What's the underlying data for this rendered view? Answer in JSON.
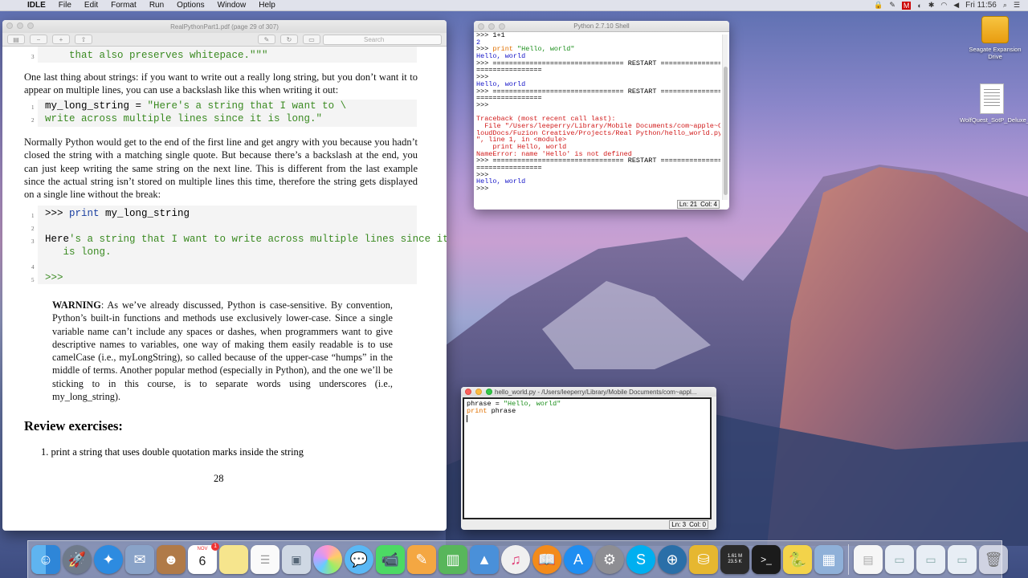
{
  "menubar": {
    "app": "IDLE",
    "items": [
      "File",
      "Edit",
      "Format",
      "Run",
      "Options",
      "Window",
      "Help"
    ],
    "clock": "Fri 11:56"
  },
  "pdf": {
    "title": "RealPythonPart1.pdf (page 29 of 307)",
    "search_placeholder": "Search",
    "code1_line3": "    that also preserves whitepace.\"\"\"",
    "para1": "One last thing about strings: if you want to write out a really long string, but you don’t want it to appear on multiple lines, you can use a backslash like this when writing it out:",
    "code2_var": "my_long_string = ",
    "code2_str1": "\"Here's a string that I want to \\",
    "code2_str2": "write across multiple lines since it is long.\"",
    "para2": "Normally Python would get to the end of the first line and get angry with you because you hadn’t closed the string with a matching single quote. But because there’s a backslash at the end, you can just keep writing the same string on the next line. This is different from the last example since the actual string isn’t stored on multiple lines this time, therefore the string gets displayed on a single line without the break:",
    "code3_prompt": ">>> ",
    "code3_kw": "print",
    "code3_rest": " my_long_string",
    "code3_out_a": "Here",
    "code3_out_b": "'s a string that I want to write across multiple lines since it",
    "code3_out_c": "   is long.",
    "code3_prompt2": ">>>",
    "warning_label": "WARNING",
    "warning_text": ": As we’ve already discussed, Python is case-sensitive. By convention, Python’s built-in functions and methods use exclusively lower-case. Since a single variable name can’t include any spaces or dashes, when programmers want to give descriptive names to variables, one way of making them easily readable is to use camelCase (i.e., myLongString), so called because of the upper-case “humps” in the middle of terms. Another popular method (especially in Python), and the one we’ll be sticking to in this course, is to separate words using underscores (i.e., my_long_string).",
    "review_heading": "Review exercises:",
    "exercise1": "1.  print a string that uses double quotation marks inside the string",
    "page_number": "28",
    "line_numbers": [
      "3",
      "1",
      "2",
      "1",
      "2",
      "3",
      "4",
      "5"
    ]
  },
  "shell": {
    "title": "Python 2.7.10 Shell",
    "lines": [
      {
        "t": ">>> 1+1",
        "c": "c-black"
      },
      {
        "t": "2",
        "c": "c-blue"
      },
      {
        "t": ">>> print \"Hello, world\"",
        "c": "c-mixed1"
      },
      {
        "t": "Hello, world",
        "c": "c-blue"
      },
      {
        "t": ">>> ================================ RESTART ================",
        "c": "c-black"
      },
      {
        "t": "================",
        "c": "c-black"
      },
      {
        "t": ">>>",
        "c": "c-black"
      },
      {
        "t": "Hello, world",
        "c": "c-blue"
      },
      {
        "t": ">>> ================================ RESTART ================",
        "c": "c-black"
      },
      {
        "t": "================",
        "c": "c-black"
      },
      {
        "t": ">>>",
        "c": "c-black"
      },
      {
        "t": "",
        "c": "c-black"
      },
      {
        "t": "Traceback (most recent call last):",
        "c": "c-red"
      },
      {
        "t": "  File \"/Users/leeperry/Library/Mobile Documents/com~apple~C",
        "c": "c-red"
      },
      {
        "t": "loudDocs/Fuzion Creative/Projects/Real Python/hello_world.py",
        "c": "c-red"
      },
      {
        "t": "\", line 1, in <module>",
        "c": "c-red"
      },
      {
        "t": "    print Hello, world",
        "c": "c-red"
      },
      {
        "t": "NameError: name 'Hello' is not defined",
        "c": "c-red"
      },
      {
        "t": ">>> ================================ RESTART ================",
        "c": "c-black"
      },
      {
        "t": "================",
        "c": "c-black"
      },
      {
        "t": ">>>",
        "c": "c-black"
      },
      {
        "t": "Hello, world",
        "c": "c-blue"
      },
      {
        "t": ">>>",
        "c": "c-black"
      }
    ],
    "status_ln": "Ln: 21",
    "status_col": "Col: 4"
  },
  "editor": {
    "title": "hello_world.py - /Users/leeperry/Library/Mobile Documents/com~appl...",
    "line1_var": "phrase = ",
    "line1_str": "\"Hello, world\"",
    "line2_kw": "print",
    "line2_rest": " phrase",
    "status_ln": "Ln: 3",
    "status_col": "Col: 0"
  },
  "desktop": {
    "drive_label": "Seagate Expansion Drive",
    "file_label": "WolfQuest_SotP_Deluxe_M...l_v25.pdf"
  },
  "dock": {
    "calendar_month": "NOV",
    "calendar_day": "6",
    "calendar_badge": "1",
    "netmon_up": "1.61 M",
    "netmon_down": "23.5 K",
    "items": [
      "finder-icon",
      "launchpad-icon",
      "safari-icon",
      "mail-icon",
      "contacts-icon",
      "calendar-icon",
      "notes-icon",
      "reminders-icon",
      "preview-icon",
      "photos-icon",
      "messages-icon",
      "facetime-icon",
      "pages-icon",
      "numbers-icon",
      "keynote-icon",
      "itunes-icon",
      "ibooks-icon",
      "app-store-icon",
      "system-preferences-icon",
      "skype-icon",
      "mindnode-icon",
      "database-icon",
      "network-monitor-icon",
      "terminal-icon",
      "python-launcher-icon",
      "image-capture-icon",
      "document-icon",
      "folder-icon",
      "folder2-icon",
      "folder3-icon",
      "trash-icon"
    ]
  }
}
